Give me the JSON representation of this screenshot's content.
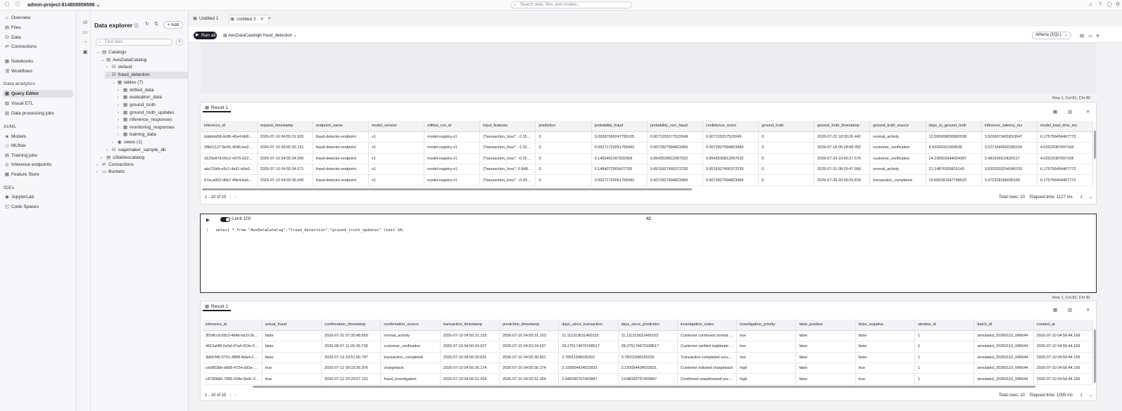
{
  "topbar": {
    "project": "admin-project-814808959598",
    "search_placeholder": "Search data, files, and models...",
    "icons": [
      "bell-icon",
      "help-icon",
      "user-icon",
      "settings-icon"
    ]
  },
  "nav": {
    "items": [
      {
        "label": "Overview",
        "icon": "⌂"
      },
      {
        "label": "Files",
        "icon": "▤"
      },
      {
        "label": "Data",
        "icon": "⛁"
      },
      {
        "label": "Connections",
        "icon": "⇄"
      },
      {
        "label": "Notebooks",
        "icon": "▦"
      },
      {
        "label": "Workflows",
        "icon": "⇶"
      }
    ],
    "section_analytics": "Data analytics",
    "analytics_items": [
      {
        "label": "Query Editor",
        "icon": "▣"
      },
      {
        "label": "Visual ETL",
        "icon": "▧"
      },
      {
        "label": "Data processing jobs",
        "icon": "▥"
      }
    ],
    "section_aiml": "AI/ML",
    "aiml_items": [
      {
        "label": "Models",
        "icon": "◈"
      },
      {
        "label": "MLflow",
        "icon": "◇"
      },
      {
        "label": "Training jobs",
        "icon": "▤"
      },
      {
        "label": "Inference endpoints",
        "icon": "◎"
      },
      {
        "label": "Feature Store",
        "icon": "▦"
      }
    ],
    "section_ides": "IDEs",
    "ide_items": [
      {
        "label": "JupyterLab",
        "icon": "◉"
      },
      {
        "label": "Code Spaces",
        "icon": "◫"
      }
    ]
  },
  "explorer": {
    "title": "Data explorer",
    "add_label": "Add",
    "find_placeholder": "Find data",
    "tree": {
      "catalogs": "Catalogs",
      "aws_catalog": "AwsDataCatalog",
      "default_db": "default",
      "fraud_db": "fraud_detection",
      "tables": "tables (7)",
      "table_names": [
        "drifted_data",
        "evaluation_data",
        "ground_truth",
        "ground_truth_updates",
        "inference_responses",
        "monitoring_responses",
        "training_data"
      ],
      "views": "views (1)",
      "sagemaker_db": "sagemaker_sample_db",
      "s3_catalog": "s3tablescatalog",
      "connections": "Connections",
      "buckets": "Buckets"
    }
  },
  "tabs": {
    "tab1": "Untitled 1",
    "tab2": "Untitled 2",
    "add": "+"
  },
  "toolbar": {
    "run_label": "Run all",
    "catalog": "AwsDataCatalog",
    "database": "fraud_detection",
    "engine": "Athena (SQL)"
  },
  "cell1": {
    "cursor": "Row 1,  Col 81,  Chr 80"
  },
  "result1": {
    "tab": "Result 1",
    "columns": [
      "inference_id",
      "request_timestamp",
      "endpoint_name",
      "model_version",
      "mlflow_run_id",
      "input_features",
      "prediction",
      "probability_fraud",
      "probability_non_fraud",
      "confidence_score",
      "ground_truth",
      "ground_truth_timestamp",
      "ground_truth_source",
      "days_to_ground_truth",
      "inference_latency_ms",
      "model_load_time_ms"
    ],
    "rows": [
      [
        "bddd4a58-dc86-46a4-bb82-f...",
        "2026-07-10 04:55:31.920",
        "fraud-detector-endpoint",
        "v1",
        "model-registry-v1",
        "{\"transaction_hour\": -2.15395...",
        "0",
        "0.09287068247795105",
        "0.9071293177522049",
        "0.907129317522049",
        "0",
        "2026-07-22 18:30:26.442",
        "normal_activity",
        "12.565908830892038",
        "3.5026073455810547",
        "6.175756454467773"
      ],
      [
        "28b61127-8e55-4096-be99-f...",
        "2026-07-10 04:55:32.151",
        "fraud-detector-endpoint",
        "v1",
        "model-registry-v1",
        "{\"transaction_hour\": -1.22919...",
        "0",
        "0.09271720051765442",
        "0.9072827994823456",
        "0.9072827994823456",
        "0",
        "2026-07-18 05:28:08.092",
        "customer_verification",
        "8.02266321004535",
        "3.5271644592285156",
        "4.02522087097168"
      ],
      [
        "d123e87d-00c2-4376-922e-8...",
        "2026-07-10 04:55:34.560",
        "fraud-detector-endpoint",
        "v1",
        "model-registry-v1",
        "{\"transaction_hour\": -0.32225...",
        "0",
        "0.1456463187932968",
        "0.8543536812067032",
        "0.8543536812067032",
        "0",
        "2026-07-24 10:40:27.579",
        "customer_verification",
        "14.239502544004397",
        "3.481626510620117",
        "4.02522087097168"
      ],
      [
        "abc21bfb-e5c1-4a91-b6a0-0...",
        "2026-07-10 04:55:34.671",
        "fraud-detector-endpoint",
        "v1",
        "model-registry-v1",
        "{\"transaction_hour\": 0.848550...",
        "0",
        "0.1484072565427765",
        "0.8515927495372235",
        "0.8515927495372235",
        "0",
        "2026-07-31 08:29:47.999",
        "normal_activity",
        "21.14876305815143",
        "3.5202503204345703",
        "6.175756454467773"
      ],
      [
        "b7eca052-d6b7-49e4-ba52-2...",
        "2026-07-10 04:55:35.040",
        "fraud-detector-endpoint",
        "v1",
        "model-registry-v1",
        "{\"transaction_hour\": -0.33240...",
        "0",
        "0.09271720051765442",
        "0.9072827994823456",
        "0.9072827994823456",
        "0",
        "2026-07-26 20:39:20.878",
        "transaction_completed",
        "16.655391647748523",
        "3.472328186035156",
        "6.175756454467773"
      ]
    ],
    "pager": "1 - 10 of 10",
    "total_rows": "Total rows: 10",
    "elapsed": "Elapsed time: 1127 ms"
  },
  "cell2": {
    "limit": "Limit 100",
    "cell_number": "#2",
    "line_number": "1",
    "code": "select * from \"AwsDataCatalog\".\"fraud_detection\".\"ground_truth_updates\" limit 10;",
    "cursor": "Row 1,  Col 82,  Chr 81"
  },
  "result2": {
    "tab": "Result 1",
    "columns": [
      "inference_id",
      "actual_fraud",
      "confirmation_timestamp",
      "confirmation_source",
      "transaction_timestamp",
      "prediction_timestamp",
      "days_since_transaction",
      "days_since_prediction",
      "investigation_notes",
      "investigation_priority",
      "false_positive",
      "false_negative",
      "window_id",
      "batch_id",
      "created_at"
    ],
    "rows": [
      [
        "3f2dfccd-59c3-4b4b-ba1f-2b...",
        "false",
        "2026-07-21 07:35:48.650",
        "normal_activity",
        "2026-07-10 04:55:31.153",
        "2026-07-10 04:55:31.153",
        "11.111313631460153",
        "11.111313631460153",
        "Customer continued normal u...",
        "low",
        "false",
        "false",
        "1",
        "simulated_20260110_045644",
        "2026-07-10 04:56:44.169"
      ],
      [
        "4412af48-0e0d-47a4-919e-5e...",
        "false",
        "2026-08-07 11:26:39.718",
        "customer_verification",
        "2026-07-10 04:50:24.627",
        "2026-07-10 04:50:24.627",
        "28.275174679198517",
        "28.275174679198517",
        "Customer verified legitimate p...",
        "low",
        "false",
        "false",
        "1",
        "simulated_20260110_045644",
        "2026-07-10 04:56:44.169"
      ],
      [
        "3bbfcf45-5751-4868-8da4-24...",
        "false",
        "2026-07-13 23:51:50.797",
        "transaction_completed",
        "2026-07-10 04:55:30.831",
        "2026-07-10 04:55:30.831",
        "3.78911998165202",
        "3.78911998165202",
        "Transaction completed succe...",
        "low",
        "false",
        "false",
        "1",
        "simulated_20260110_045644",
        "2026-07-10 04:56:44.169"
      ],
      [
        "ce0853bb-dd08-4724-a82a-d...",
        "true",
        "2026-07-12 09:33:36.976",
        "chargeback",
        "2026-07-10 04:55:36.174",
        "2026-07-10 04:55:36.174",
        "2.193054424532831",
        "2.193054424532831",
        "Customer initiated chargeback",
        "high",
        "false",
        "true",
        "1",
        "simulated_20260110_045644",
        "2026-07-10 04:56:44.169"
      ],
      [
        "c4790b86-7905-428e-8a9c-2...",
        "true",
        "2026-07-12 20:29:07.131",
        "fraud_investigation",
        "2026-07-10 04:55:31.354",
        "2026-07-10 04:55:31.354",
        "2.648330757403847",
        "2.648330757403847",
        "Confirmed unauthorized purc...",
        "high",
        "false",
        "true",
        "1",
        "simulated_20260110_045644",
        "2026-07-10 04:56:44.169"
      ]
    ],
    "pager": "1 - 10 of 10",
    "total_rows": "Total rows: 10",
    "elapsed": "Elapsed time: 1009 ms"
  }
}
